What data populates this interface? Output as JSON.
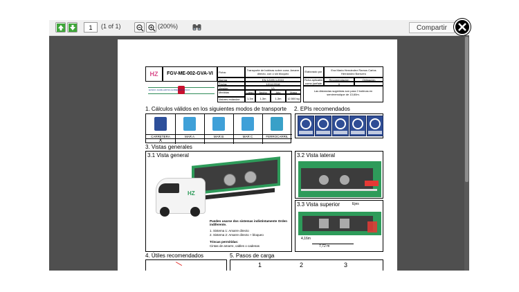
{
  "toolbar": {
    "page_value": "1",
    "page_count": "(1 of 1)",
    "zoom": "(200%)",
    "share_label": "Compartir"
  },
  "doc_header": {
    "logo": "HZ",
    "code": "FGV-ME-002-GVA-VI",
    "ficha_label": "Ficha:",
    "ficha_value": "Transporte de bobinas sobre cuna. Amarre directo, con o sin bloqueo",
    "norma_label": "Norma",
    "norma_value": "EN 12195.1:2010",
    "fecha_label": "Fecha:",
    "fecha_value": "12/12/2018",
    "version_label": "Versión:",
    "version_value": "V1",
    "medidas_label": "Medidas",
    "largo": "Largo",
    "ancho": "Ancho",
    "alto": "Alto",
    "masa": "Masa",
    "largo_v": "1,3m",
    "ancho_v": "1,3m",
    "alto_v": "1,3m",
    "masa_v": "12.500 kg",
    "valores_label": "Valores estándar:",
    "elaborado_label": "Elaborado por",
    "elaborado_value": "Eva María Hernández Ramos Carlos Hernández Barruero",
    "aplicable_label": "Ficha aplicable como (señale x)",
    "recomendacion": "Recomendación",
    "obligacion": "Obligación",
    "mark": "X",
    "distancias": "Las distancias sugeridas son para 2 bobinas en semirremolque de 13,60m.",
    "gov_label": "EUSKO JAURLARITZA   GOBIERNO VASCO"
  },
  "sections": {
    "s1": "1. Cálculos válidos en los siguientes modos de transporte",
    "s2": "2. EPIs recomendados",
    "s3": "3. Vistas generales",
    "s31": "3.1 Vista general",
    "s32": "3.2 Vista lateral",
    "s33": "3.3 Vista superior",
    "s4": "4. Útiles recomendados",
    "s5": "5. Pasos de carga"
  },
  "modes": [
    "CARRETERA",
    "MAR A",
    "MAR B",
    "MAR C",
    "FERROCARRIL"
  ],
  "mode_mark": "X",
  "epis": [
    "CASCO DE SEGURIDAD",
    "GAFAS",
    "CHALECO",
    "BOTAS",
    "GUANTES"
  ],
  "vista_general": {
    "text1": "Pueden usarse dos sistemas indistintamente Orden indiferente.",
    "item1": "1.   Sistema 1: Amarre directo",
    "item2": "2.   Sistema 2: Amarre directo + bloqueo",
    "trincas_title": "Trincas permitidas:",
    "trincas_value": "Cintas de amarre, cables o cadenas",
    "brand": "HZ"
  },
  "vista_superior": {
    "ejes": "Ejes",
    "dim1": "4,16m",
    "dim2": "7,72 m"
  },
  "pasos": [
    "1",
    "2",
    "3"
  ]
}
